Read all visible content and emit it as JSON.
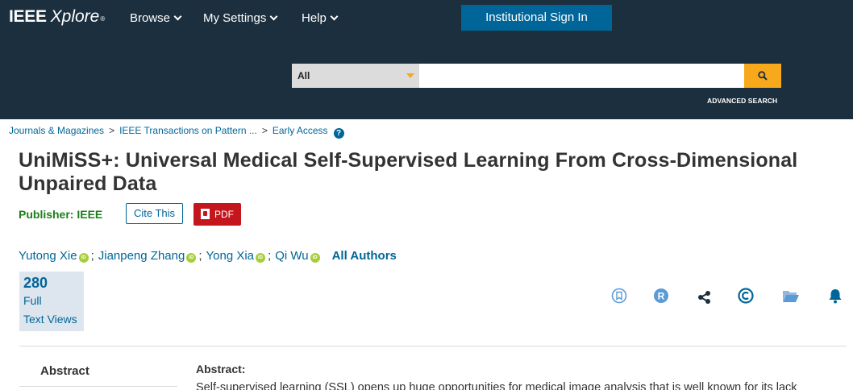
{
  "header": {
    "logo_brand": "IEEE",
    "logo_product": "Xplore",
    "logo_mark": "®",
    "nav": [
      {
        "label": "Browse"
      },
      {
        "label": "My Settings"
      },
      {
        "label": "Help"
      }
    ],
    "signin_label": "Institutional Sign In",
    "search": {
      "scope": "All",
      "value": "",
      "placeholder": ""
    },
    "advanced_search": "ADVANCED SEARCH"
  },
  "breadcrumb": {
    "items": [
      "Journals & Magazines",
      "IEEE Transactions on Pattern ...",
      "Early Access"
    ],
    "separator": ">",
    "help_glyph": "?"
  },
  "article": {
    "title": "UniMiSS+: Universal Medical Self-Supervised Learning From Cross-Dimensional Unpaired Data",
    "publisher_label": "Publisher:",
    "publisher": "IEEE",
    "cite_label": "Cite This",
    "pdf_label": "PDF",
    "authors": [
      {
        "name": "Yutong Xie"
      },
      {
        "name": "Jianpeng Zhang"
      },
      {
        "name": "Yong Xia"
      },
      {
        "name": "Qi Wu"
      }
    ],
    "orcid_badge": "iD",
    "author_separator": ";",
    "all_authors_label": "All Authors",
    "metrics": {
      "count": "280",
      "line1": "Full",
      "line2": "Text Views"
    },
    "actions": [
      "bookmark-icon",
      "rights-icon",
      "share-icon",
      "copyright-icon",
      "folder-icon",
      "alert-bell-icon"
    ]
  },
  "abstract": {
    "nav_label": "Abstract",
    "heading": "Abstract:",
    "text": "Self-supervised learning (SSL) opens up huge opportunities for medical image analysis that is well known for its lack"
  },
  "colors": {
    "header_bg": "#1c2f3e",
    "accent_blue": "#006699",
    "search_accent": "#f7a81b",
    "pdf_red": "#c4161c",
    "publisher_green": "#1b7f1b",
    "orcid_green": "#a6ce39"
  }
}
